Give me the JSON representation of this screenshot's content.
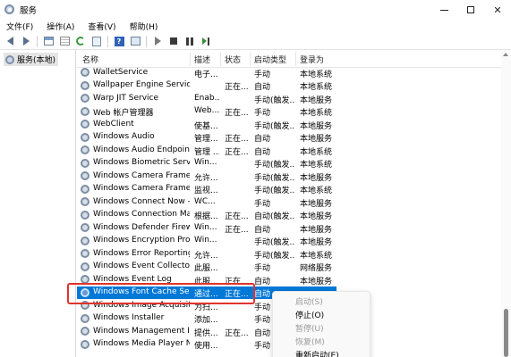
{
  "window": {
    "title": "服务",
    "minimize_glyph": "",
    "maximize_glyph": "",
    "close_glyph": "✕"
  },
  "menubar": {
    "items": [
      "文件(F)",
      "操作(A)",
      "查看(V)",
      "帮助(H)"
    ]
  },
  "toolbar": {
    "icons": [
      "back-icon",
      "forward-icon",
      "console-tree-icon",
      "list-view-icon",
      "refresh-icon",
      "export-list-icon",
      "help-icon",
      "properties-icon",
      "start-service-icon",
      "stop-service-icon",
      "pause-service-icon",
      "restart-service-icon"
    ],
    "help_glyph": "?"
  },
  "tree": {
    "selected_label": "服务(本地)"
  },
  "columns": {
    "name": "名称",
    "description": "描述",
    "status": "状态",
    "startup_type": "启动类型",
    "logon_as": "登录为"
  },
  "services": [
    {
      "name": "WalletService",
      "description": "电子...",
      "status": "",
      "startup_type": "手动",
      "logon_as": "本地系统"
    },
    {
      "name": "Wallpaper Engine Service",
      "description": "",
      "status": "正在...",
      "startup_type": "自动",
      "logon_as": "本地系统"
    },
    {
      "name": "Warp JIT Service",
      "description": "Enab...",
      "status": "",
      "startup_type": "手动(触发...",
      "logon_as": "本地服务"
    },
    {
      "name": "Web 帐户管理器",
      "description": "Web...",
      "status": "正在...",
      "startup_type": "手动",
      "logon_as": "本地系统"
    },
    {
      "name": "WebClient",
      "description": "使基...",
      "status": "",
      "startup_type": "手动(触发...",
      "logon_as": "本地服务"
    },
    {
      "name": "Windows Audio",
      "description": "管理...",
      "status": "正在...",
      "startup_type": "自动",
      "logon_as": "本地服务"
    },
    {
      "name": "Windows Audio Endpoint B...",
      "description": "管理 ...",
      "status": "正在...",
      "startup_type": "自动",
      "logon_as": "本地系统"
    },
    {
      "name": "Windows Biometric Service",
      "description": "Win...",
      "status": "",
      "startup_type": "手动(触发...",
      "logon_as": "本地系统"
    },
    {
      "name": "Windows Camera Frame S...",
      "description": "允许...",
      "status": "",
      "startup_type": "手动(触发...",
      "logon_as": "本地服务"
    },
    {
      "name": "Windows Camera Frame S...",
      "description": "监视...",
      "status": "",
      "startup_type": "手动(触发...",
      "logon_as": "本地系统"
    },
    {
      "name": "Windows Connect Now - C...",
      "description": "WC...",
      "status": "",
      "startup_type": "手动",
      "logon_as": "本地服务"
    },
    {
      "name": "Windows Connection Man...",
      "description": "根据...",
      "status": "正在...",
      "startup_type": "自动(触发...",
      "logon_as": "本地服务"
    },
    {
      "name": "Windows Defender Firewall",
      "description": "Win...",
      "status": "正在...",
      "startup_type": "自动",
      "logon_as": "本地服务"
    },
    {
      "name": "Windows Encryption Provid...",
      "description": "Win...",
      "status": "",
      "startup_type": "手动(触发...",
      "logon_as": "本地服务"
    },
    {
      "name": "Windows Error Reporting S...",
      "description": "允许...",
      "status": "",
      "startup_type": "手动(触发...",
      "logon_as": "本地系统"
    },
    {
      "name": "Windows Event Collector",
      "description": "此服...",
      "status": "",
      "startup_type": "手动",
      "logon_as": "网络服务"
    },
    {
      "name": "Windows Event Log",
      "description": "此服...",
      "status": "正在...",
      "startup_type": "自动",
      "logon_as": "本地服务"
    },
    {
      "name": "Windows Font Cache Servi...",
      "description": "通过...",
      "status": "正在...",
      "startup_type": "自动",
      "logon_as": ""
    },
    {
      "name": "Windows Image Acquisitio...",
      "description": "为扫...",
      "status": "",
      "startup_type": "手动",
      "logon_as": ""
    },
    {
      "name": "Windows Installer",
      "description": "添加...",
      "status": "",
      "startup_type": "手动",
      "logon_as": ""
    },
    {
      "name": "Windows Management Ins...",
      "description": "提供...",
      "status": "正在...",
      "startup_type": "自动",
      "logon_as": ""
    },
    {
      "name": "Windows Media Player Net...",
      "description": "使用...",
      "status": "",
      "startup_type": "手动",
      "logon_as": ""
    }
  ],
  "context_menu": {
    "items": [
      {
        "label": "启动(S)",
        "enabled": false
      },
      {
        "label": "停止(O)",
        "enabled": true
      },
      {
        "label": "暂停(U)",
        "enabled": false
      },
      {
        "label": "恢复(M)",
        "enabled": false
      },
      {
        "label": "重新启动(E)",
        "enabled": true
      }
    ]
  },
  "selected_row_index": 17,
  "colors": {
    "selection": "#0078d7",
    "highlight_border": "#e0342c"
  }
}
